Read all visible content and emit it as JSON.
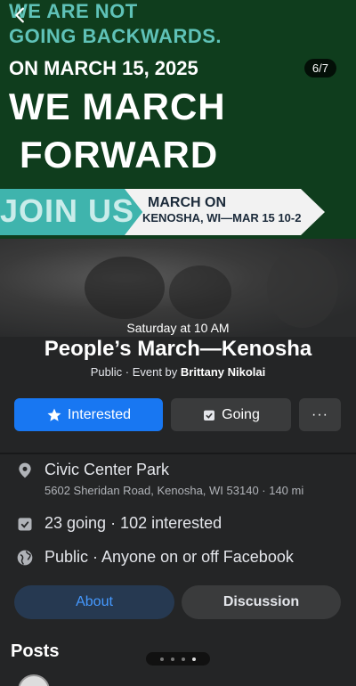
{
  "banner": {
    "line1": "WE ARE NOT",
    "line2": "GOING BACKWARDS.",
    "line3": "ON MARCH 15, 2025",
    "line4": "WE MARCH",
    "line5": "FORWARD",
    "join": "JOIN US",
    "arrow_line1": "MARCH ON",
    "arrow_line2": "KENOSHA, WI—MAR 15 10-2",
    "pager": "6/7"
  },
  "event": {
    "date": "Saturday at 10 AM",
    "title": "People’s March—Kenosha",
    "privacy_prefix": "Public · Event by ",
    "host": "Brittany Nikolai"
  },
  "actions": {
    "interested": "Interested",
    "going": "Going",
    "more": "···"
  },
  "details": {
    "place": "Civic Center Park",
    "address": "5602 Sheridan Road, Kenosha, WI 53140 · 140 mi",
    "attendance": "23 going · 102 interested",
    "visibility": "Public · Anyone on or off Facebook"
  },
  "tabs": {
    "about": "About",
    "discussion": "Discussion"
  },
  "posts_heading": "Posts",
  "colors": {
    "accent": "#1877f2",
    "background": "#242526",
    "banner_green": "#0f3d1d",
    "teal": "#3fb4ad"
  },
  "icons": [
    "back-chevron-icon",
    "star-icon",
    "calendar-check-icon",
    "location-pin-icon",
    "calendar-icon",
    "globe-icon"
  ]
}
